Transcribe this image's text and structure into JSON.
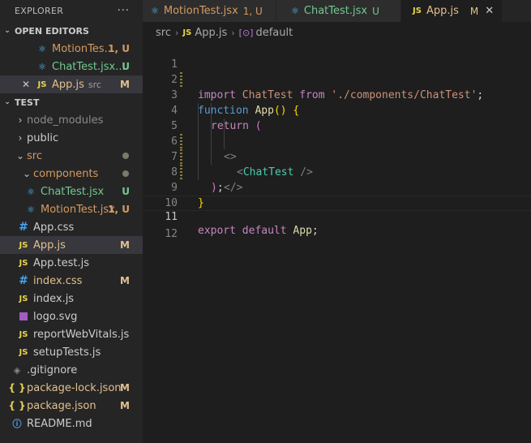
{
  "explorer": {
    "title": "EXPLORER",
    "more": "···",
    "open_editors": {
      "label": "OPEN EDITORS",
      "items": [
        {
          "name": "MotionTes...",
          "status": "1, U",
          "icon": "react-icon"
        },
        {
          "name": "ChatTest.jsx...",
          "status": "U",
          "icon": "react-icon"
        },
        {
          "name": "App.js",
          "desc": "src",
          "status": "M",
          "icon": "js-icon",
          "close": "✕"
        }
      ]
    },
    "project": {
      "label": "TEST",
      "items": [
        {
          "name": "node_modules"
        },
        {
          "name": "public"
        },
        {
          "name": "src"
        },
        {
          "name": "components"
        },
        {
          "name": "ChatTest.jsx",
          "status": "U"
        },
        {
          "name": "MotionTest.jsx",
          "status": "1, U"
        },
        {
          "name": "App.css"
        },
        {
          "name": "App.js",
          "status": "M"
        },
        {
          "name": "App.test.js"
        },
        {
          "name": "index.css",
          "status": "M"
        },
        {
          "name": "index.js"
        },
        {
          "name": "logo.svg"
        },
        {
          "name": "reportWebVitals.js"
        },
        {
          "name": "setupTests.js"
        },
        {
          "name": ".gitignore"
        },
        {
          "name": "package-lock.json",
          "status": "M"
        },
        {
          "name": "package.json",
          "status": "M"
        },
        {
          "name": "README.md"
        }
      ]
    }
  },
  "tabs": [
    {
      "name": "MotionTest.jsx",
      "flag": "1, U"
    },
    {
      "name": "ChatTest.jsx",
      "flag": "U"
    },
    {
      "name": "App.js",
      "flag": "M",
      "close": "✕"
    }
  ],
  "breadcrumb": {
    "folder": "src",
    "file": "App.js",
    "symbol": "default",
    "js_glyph": "JS",
    "symbol_glyph": "[⊙]",
    "sep": "›"
  },
  "code": {
    "line_numbers": [
      "1",
      "2",
      "3",
      "4",
      "5",
      "6",
      "7",
      "8",
      "9",
      "10",
      "11",
      "12"
    ],
    "l1": {
      "kw": "import",
      "id": " ChatTest ",
      "from": "from",
      "str": " './components/ChatTest'",
      "semi": ";"
    },
    "l3": {
      "kw": "function",
      "fn": " App",
      "paren": "()",
      "brace": " {"
    },
    "l4": {
      "kw": "return",
      "paren": " ("
    },
    "l5": {
      "open": "<>"
    },
    "l6": {
      "lt": "<",
      "tag": "ChatTest",
      "end": " />"
    },
    "l7": {
      "close": "</>"
    },
    "l8": {
      "paren": ")",
      "semi": ";"
    },
    "l9": {
      "brace": "}"
    },
    "l11": {
      "kw": "export",
      "def": " default",
      "id": " App",
      "semi": ";"
    }
  },
  "icons": {
    "js": "JS",
    "react": "⚛",
    "css": "#",
    "json": "{ }",
    "info": "ⓘ",
    "git": "◈",
    "folder_open": "⌄",
    "folder_closed": "›"
  },
  "colors": {
    "untracked": "#73c991",
    "modified": "#e2c08d",
    "error": "#d59a60"
  }
}
